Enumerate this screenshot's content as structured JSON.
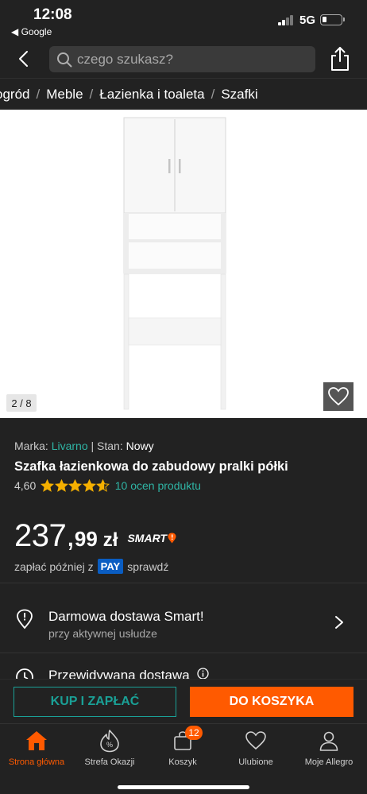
{
  "status_bar": {
    "time": "12:08",
    "back_app": "◀ Google",
    "network": "5G"
  },
  "search": {
    "placeholder": "czego szukasz?"
  },
  "breadcrumb": [
    "ogród",
    "Meble",
    "Łazienka i toaleta",
    "Szafki"
  ],
  "gallery": {
    "counter": "2 / 8"
  },
  "product": {
    "brand_label": "Marka:",
    "brand": "Livarno",
    "state_label": "| Stan:",
    "state": "Nowy",
    "title": "Szafka łazienkowa do zabudowy pralki półki",
    "rating": "4,60",
    "rating_stars": 4.6,
    "reviews": "10 ocen produktu"
  },
  "price": {
    "main": "237,",
    "decimal": "99",
    "currency": "zł",
    "smart": "SMART"
  },
  "pay_later": {
    "prefix": "zapłać później z",
    "badge": "PAY",
    "suffix": "sprawdź"
  },
  "delivery": {
    "title": "Darmowa dostawa Smart!",
    "subtitle": "przy aktywnej usłudze"
  },
  "expected_delivery": {
    "title": "Przewidywana dostawa"
  },
  "actions": {
    "buy_now": "KUP I ZAPŁAĆ",
    "add_to_cart": "DO KOSZYKA"
  },
  "tabbar": {
    "items": [
      {
        "label": "Strona główna",
        "icon": "home-icon"
      },
      {
        "label": "Strefa Okazji",
        "icon": "deals-icon"
      },
      {
        "label": "Koszyk",
        "icon": "cart-icon",
        "badge": "12"
      },
      {
        "label": "Ulubione",
        "icon": "heart-icon"
      },
      {
        "label": "Moje Allegro",
        "icon": "user-icon"
      }
    ]
  },
  "colors": {
    "accent": "#ff5a00",
    "teal": "#1aa096",
    "link": "#2fb5a5",
    "background": "#222222"
  }
}
